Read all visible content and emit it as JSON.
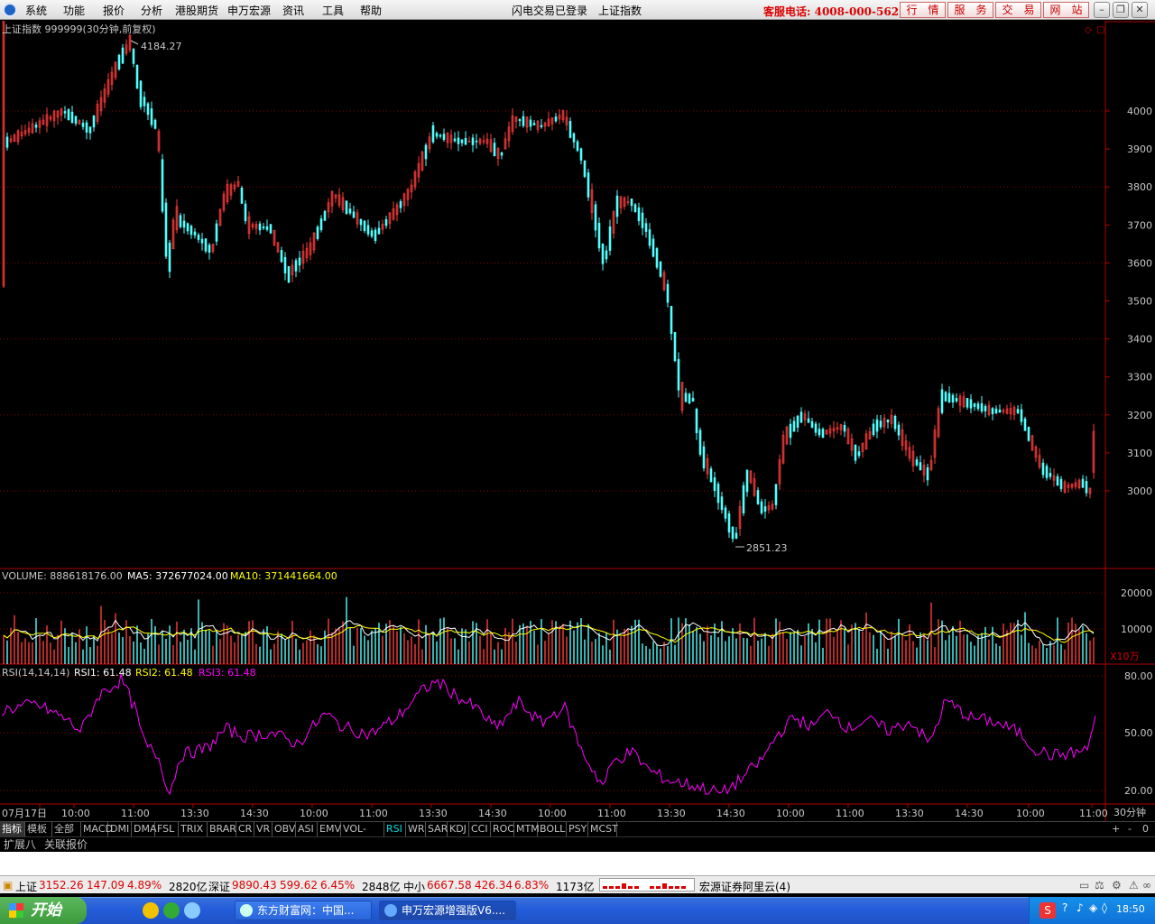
{
  "menu": [
    "系统",
    "功能",
    "报价",
    "分析",
    "港股期货",
    "申万宏源",
    "资讯",
    "工具",
    "帮助"
  ],
  "connection": {
    "status": "闪电交易已登录",
    "symbol_name": "上证指数"
  },
  "hotline": "客服电话: 4008-000-562",
  "top_buttons": [
    "行　情",
    "服　务",
    "交　易",
    "网　站"
  ],
  "chart": {
    "title": "上证指数 999999(30分钟,前复权)",
    "price_axis": [
      "4000",
      "3900",
      "3800",
      "3700",
      "3600",
      "3500",
      "3400",
      "3300",
      "3200",
      "3100",
      "3000"
    ],
    "high_label": "4184.27",
    "low_label": "2851.23"
  },
  "volume": {
    "label_name": "VOLUME: 888618176.00",
    "label_ma5": "MA5: 372677024.00",
    "label_ma10": "MA10: 371441664.00",
    "axis": [
      "20000",
      "10000"
    ],
    "unit": "X10万"
  },
  "rsi": {
    "label_name": "RSI(14,14,14)",
    "label_rsi1": "RSI1: 61.48",
    "label_rsi2": "RSI2: 61.48",
    "label_rsi3": "RSI3: 61.48",
    "axis": [
      "80.00",
      "50.00",
      "20.00"
    ]
  },
  "time_axis": [
    "07月17日",
    "10:00",
    "11:00",
    "13:30",
    "14:30",
    "10:00",
    "11:00",
    "13:30",
    "14:30",
    "10:00",
    "11:00",
    "13:30",
    "14:30",
    "10:00",
    "11:00",
    "13:30",
    "14:30",
    "10:00",
    "11:00"
  ],
  "period": "30分钟",
  "indicator_tabs": [
    "指标",
    "模板",
    "全部",
    "MACD",
    "DMI",
    "DMA",
    "FSL",
    "TRIX",
    "BRAR",
    "CR",
    "VR",
    "OBV",
    "ASI",
    "EMV",
    "VOL-TDX",
    "RSI",
    "WR",
    "SAR",
    "KDJ",
    "CCI",
    "ROC",
    "MTM",
    "BOLL",
    "PSY",
    "MCST"
  ],
  "sub_tabs": [
    "扩展八",
    "关联报价"
  ],
  "status": {
    "sh_name": "上证",
    "sh_price": "3152.26",
    "sh_chg": "147.09",
    "sh_pct": "4.89%",
    "sh_amt": "2820亿",
    "sz_name": "深证",
    "sz_price": "9890.43",
    "sz_chg": "599.62",
    "sz_pct": "6.45%",
    "sz_amt": "2848亿",
    "zx_name": "中小",
    "zx_price": "6667.58",
    "zx_chg": "426.34",
    "zx_pct": "6.83%",
    "zx_amt": "1173亿",
    "server": "宏源证券阿里云(4)"
  },
  "taskbar": {
    "start": "开始",
    "tasks": [
      "东方财富网：中国...",
      "申万宏源增强版V6...."
    ],
    "clock": "18:50"
  },
  "colors": {
    "up": "#ff3c3c",
    "down": "#54ffff",
    "ma5": "#ffffff",
    "ma10": "#ffff00",
    "rsi": "#ff00ff",
    "grid": "#8b0000",
    "axis": "#b00000"
  }
}
